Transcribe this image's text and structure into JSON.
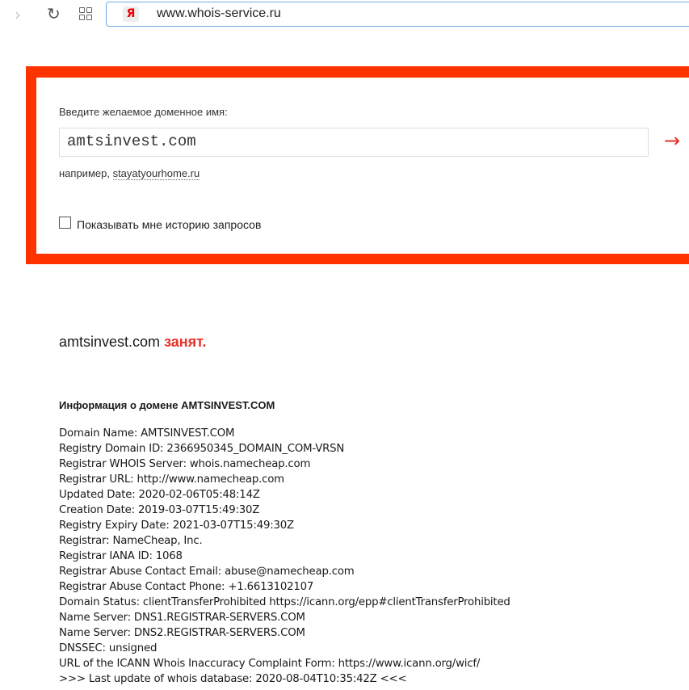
{
  "browser": {
    "url": "www.whois-service.ru",
    "search_engine_badge": "Я"
  },
  "form": {
    "label": "Введите желаемое доменное имя:",
    "value": "amtsinvest.com",
    "submit_arrow": "→",
    "example_prefix": "например, ",
    "example_link": "stayatyourhome.ru",
    "history_checkbox_label": "Показывать мне историю запросов",
    "history_checked": false
  },
  "result": {
    "domain": "amtsinvest.com",
    "status": "занят.",
    "info_heading": "Информация о домене AMTSINVEST.COM",
    "lines": [
      "Domain Name: AMTSINVEST.COM",
      "Registry Domain ID: 2366950345_DOMAIN_COM-VRSN",
      "Registrar WHOIS Server: whois.namecheap.com",
      "Registrar URL: http://www.namecheap.com",
      "Updated Date: 2020-02-06T05:48:14Z",
      "Creation Date: 2019-03-07T15:49:30Z",
      "Registry Expiry Date: 2021-03-07T15:49:30Z",
      "Registrar: NameCheap, Inc.",
      "Registrar IANA ID: 1068",
      "Registrar Abuse Contact Email: abuse@namecheap.com",
      "Registrar Abuse Contact Phone: +1.6613102107",
      "Domain Status: clientTransferProhibited https://icann.org/epp#clientTransferProhibited",
      "Name Server: DNS1.REGISTRAR-SERVERS.COM",
      "Name Server: DNS2.REGISTRAR-SERVERS.COM",
      "DNSSEC: unsigned",
      "URL of the ICANN Whois Inaccuracy Complaint Form: https://www.icann.org/wicf/",
      ">>> Last update of whois database: 2020-08-04T10:35:42Z <<<"
    ]
  },
  "colors": {
    "accent": "#ff3300",
    "status_busy": "#e8322a"
  }
}
